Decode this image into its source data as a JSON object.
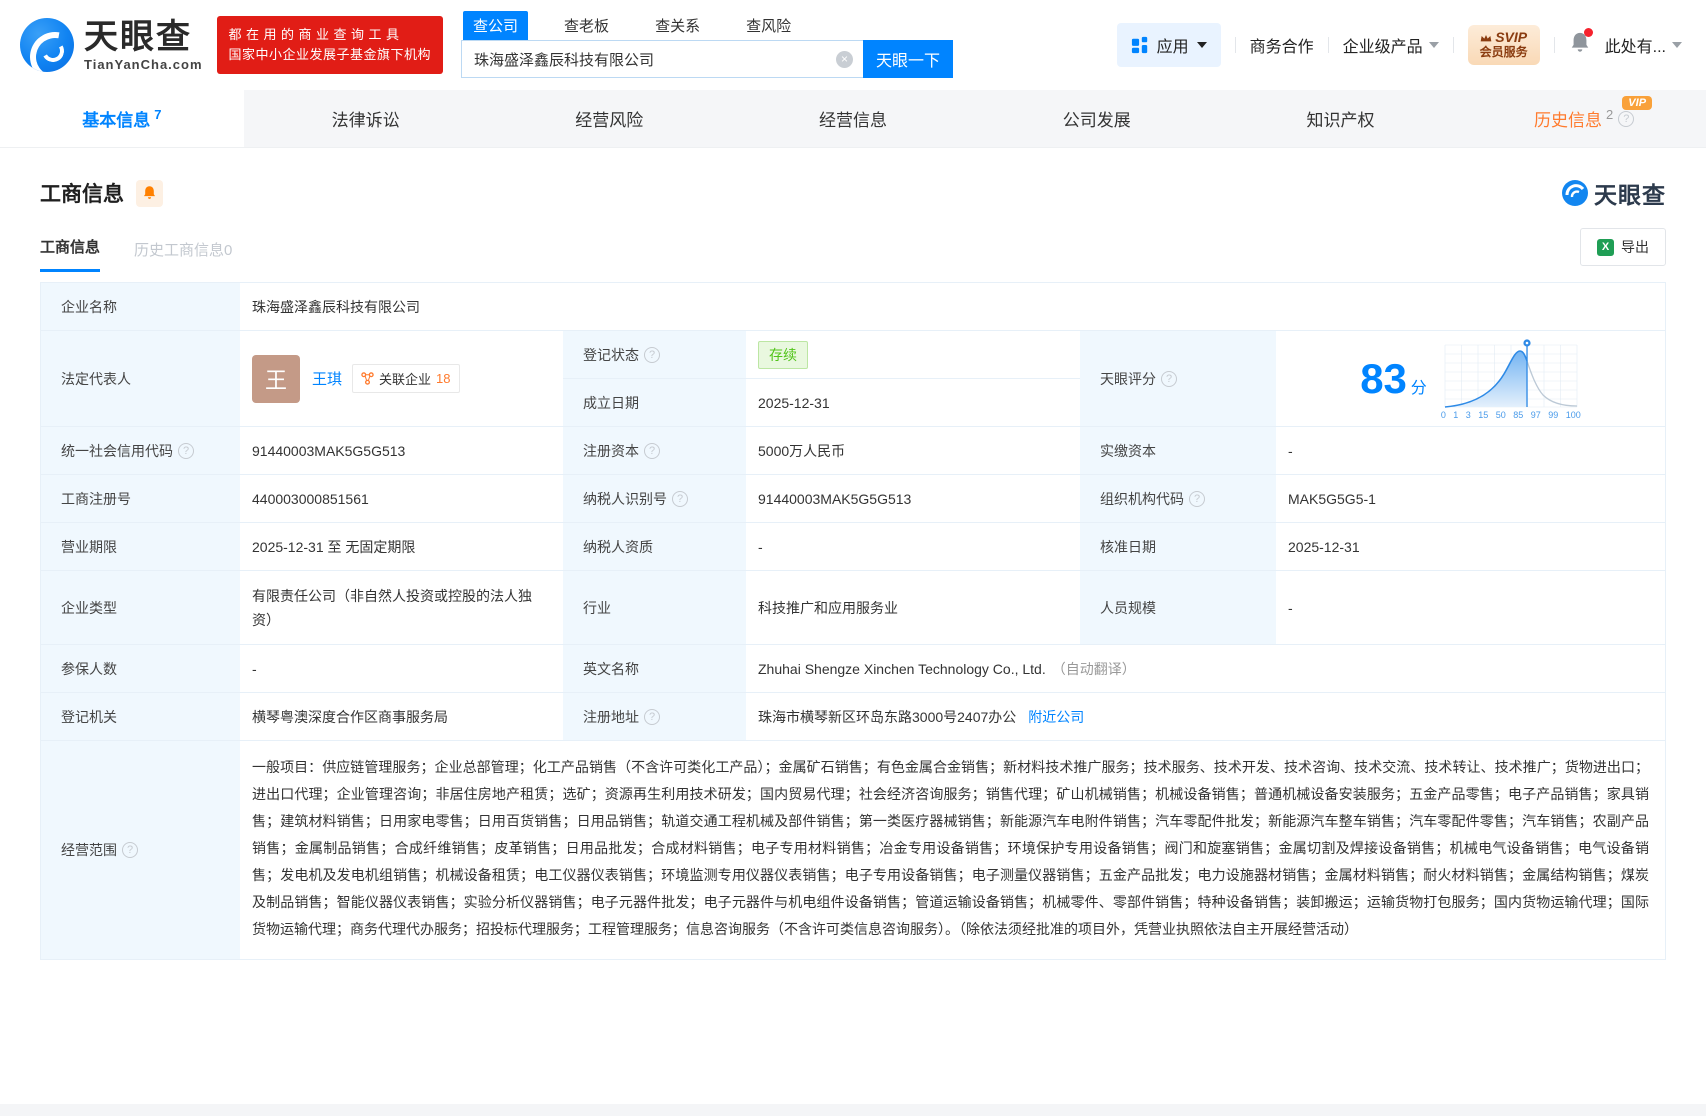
{
  "icons": {
    "help": "?",
    "clear": "×",
    "excel": "X"
  },
  "header": {
    "logo": {
      "title": "天眼查",
      "subtitle": "TianYanCha.com"
    },
    "promo": {
      "line1": "都在用的商业查询工具",
      "line2": "国家中小企业发展子基金旗下机构"
    },
    "search": {
      "tabs": [
        {
          "label": "查公司"
        },
        {
          "label": "查老板"
        },
        {
          "label": "查关系"
        },
        {
          "label": "查风险"
        }
      ],
      "value": "珠海盛泽鑫辰科技有限公司",
      "button": "天眼一下"
    },
    "menu": {
      "apps": "应用",
      "cooperation": "商务合作",
      "enterprise": "企业级产品",
      "vip_line1": "SVIP",
      "vip_line2": "会员服务",
      "user": "此处有..."
    }
  },
  "nav_tabs": [
    {
      "label": "基本信息",
      "count": "7"
    },
    {
      "label": "法律诉讼"
    },
    {
      "label": "经营风险"
    },
    {
      "label": "经营信息"
    },
    {
      "label": "公司发展"
    },
    {
      "label": "知识产权"
    },
    {
      "label": "历史信息",
      "count": "2",
      "vip": "VIP"
    }
  ],
  "section": {
    "title": "工商信息",
    "watermark": "天眼查",
    "subtabs": [
      {
        "label": "工商信息"
      },
      {
        "label": "历史工商信息0"
      }
    ],
    "export_label": "导出"
  },
  "table": {
    "company_name": {
      "label": "企业名称",
      "value": "珠海盛泽鑫辰科技有限公司"
    },
    "legal_rep": {
      "label": "法定代表人",
      "avatar_char": "王",
      "name": "王琪",
      "related_label": "关联企业",
      "related_count": "18"
    },
    "reg_status": {
      "label": "登记状态",
      "value": "存续"
    },
    "est_date": {
      "label": "成立日期",
      "value": "2025-12-31"
    },
    "score": {
      "label": "天眼评分",
      "value": "83",
      "unit": "分"
    },
    "rows": [
      {
        "cells": [
          {
            "label": "统一社会信用代码",
            "value": "91440003MAK5G5G513"
          },
          {
            "label": "注册资本",
            "value": "5000万人民币"
          },
          {
            "label": "实缴资本",
            "value": "-"
          }
        ]
      },
      {
        "cells": [
          {
            "label": "工商注册号",
            "value": "440003000851561"
          },
          {
            "label": "纳税人识别号",
            "value": "91440003MAK5G5G513"
          },
          {
            "label": "组织机构代码",
            "value": "MAK5G5G5-1"
          }
        ]
      },
      {
        "cells": [
          {
            "label": "营业期限",
            "value": "2025-12-31 至 无固定期限"
          },
          {
            "label": "纳税人资质",
            "value": "-"
          },
          {
            "label": "核准日期",
            "value": "2025-12-31"
          }
        ]
      },
      {
        "cells": [
          {
            "label": "企业类型",
            "value": "有限责任公司（非自然人投资或控股的法人独资）"
          },
          {
            "label": "行业",
            "value": "科技推广和应用服务业"
          },
          {
            "label": "人员规模",
            "value": "-"
          }
        ]
      }
    ],
    "insured": {
      "label": "参保人数",
      "value": "-"
    },
    "english_name": {
      "label": "英文名称",
      "value": "Zhuhai Shengze Xinchen Technology Co., Ltd.",
      "note": "（自动翻译）"
    },
    "reg_authority": {
      "label": "登记机关",
      "value": "横琴粤澳深度合作区商事服务局"
    },
    "reg_address": {
      "label": "注册地址",
      "value": "珠海市横琴新区环岛东路3000号2407办公",
      "link": "附近公司"
    },
    "scope": {
      "label": "经营范围",
      "text": "一般项目：供应链管理服务；企业总部管理；化工产品销售（不含许可类化工产品）；金属矿石销售；有色金属合金销售；新材料技术推广服务；技术服务、技术开发、技术咨询、技术交流、技术转让、技术推广；货物进出口；进出口代理；企业管理咨询；非居住房地产租赁；选矿；资源再生利用技术研发；国内贸易代理；社会经济咨询服务；销售代理；矿山机械销售；机械设备销售；普通机械设备安装服务；五金产品零售；电子产品销售；家具销售；建筑材料销售；日用家电零售；日用百货销售；日用品销售；轨道交通工程机械及部件销售；第一类医疗器械销售；新能源汽车电附件销售；汽车零配件批发；新能源汽车整车销售；汽车零配件零售；汽车销售；农副产品销售；金属制品销售；合成纤维销售；皮革销售；日用品批发；合成材料销售；电子专用材料销售；冶金专用设备销售；环境保护专用设备销售；阀门和旋塞销售；金属切割及焊接设备销售；机械电气设备销售；电气设备销售；发电机及发电机组销售；机械设备租赁；电工仪器仪表销售；环境监测专用仪器仪表销售；电子专用设备销售；电子测量仪器销售；五金产品批发；电力设施器材销售；金属材料销售；耐火材料销售；金属结构销售；煤炭及制品销售；智能仪器仪表销售；实验分析仪器销售；电子元器件批发；电子元器件与机电组件设备销售；管道运输设备销售；机械零件、零部件销售；特种设备销售；装卸搬运；运输货物打包服务；国内货物运输代理；国际货物运输代理；商务代理代办服务；招投标代理服务；工程管理服务；信息咨询服务（不含许可类信息咨询服务）。（除依法须经批准的项目外，凭营业执照依法自主开展经营活动）"
    }
  },
  "score_chart": {
    "type": "area",
    "score": 83,
    "ticks": [
      "0",
      "1",
      "3",
      "15",
      "50",
      "85",
      "97",
      "99",
      "100"
    ],
    "accent_color": "#0084ff"
  }
}
